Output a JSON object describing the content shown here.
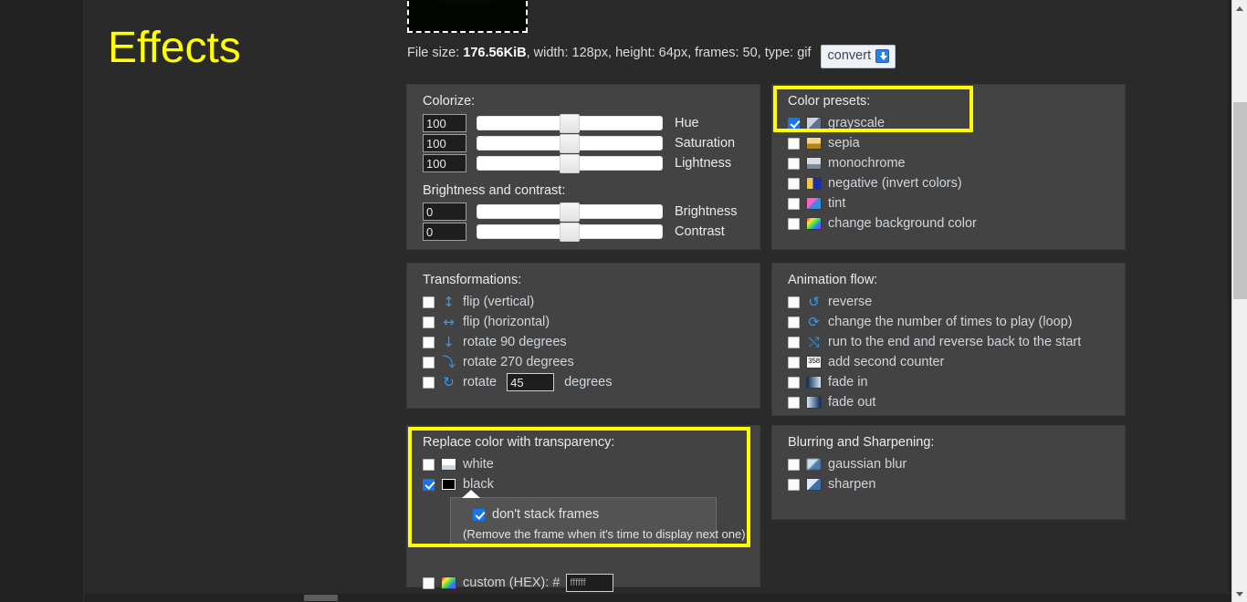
{
  "page": {
    "title": "Effects",
    "title_color": "#ffff00",
    "highlight_color": "#ffff00"
  },
  "preview": {
    "alt": "animated gif preview thumbnail",
    "file_info_prefix": "File size:",
    "file_size": "176.56KiB",
    "file_info_rest": ", width: 128px, height: 64px, frames: 50, type: gif",
    "convert_label": "convert",
    "convert_icon": "download-icon"
  },
  "colorize": {
    "title": "Colorize:",
    "sliders": [
      {
        "value": "100",
        "label": "Hue",
        "position_pct": 50
      },
      {
        "value": "100",
        "label": "Saturation",
        "position_pct": 50
      },
      {
        "value": "100",
        "label": "Lightness",
        "position_pct": 50
      }
    ],
    "brightness_title": "Brightness and contrast:",
    "bc_sliders": [
      {
        "value": "0",
        "label": "Brightness",
        "position_pct": 50
      },
      {
        "value": "0",
        "label": "Contrast",
        "position_pct": 50
      }
    ]
  },
  "color_presets": {
    "title": "Color presets:",
    "items": [
      {
        "label": "grayscale",
        "checked": true,
        "icon": "grayscale-swatch-icon"
      },
      {
        "label": "sepia",
        "checked": false,
        "icon": "sepia-swatch-icon"
      },
      {
        "label": "monochrome",
        "checked": false,
        "icon": "monochrome-swatch-icon"
      },
      {
        "label": "negative (invert colors)",
        "checked": false,
        "icon": "negative-swatch-icon"
      },
      {
        "label": "tint",
        "checked": false,
        "icon": "tint-swatch-icon"
      },
      {
        "label": "change background color",
        "checked": false,
        "icon": "color-wheel-swatch-icon"
      }
    ]
  },
  "transformations": {
    "title": "Transformations:",
    "items": [
      {
        "label": "flip (vertical)",
        "checked": false,
        "icon": "flip-vertical-arrow-icon",
        "glyph": "↕"
      },
      {
        "label": "flip (horizontal)",
        "checked": false,
        "icon": "flip-horizontal-arrow-icon",
        "glyph": "↔"
      },
      {
        "label": "rotate 90 degrees",
        "checked": false,
        "icon": "rotate-90-arrow-icon",
        "glyph": "↓"
      },
      {
        "label": "rotate 270 degrees",
        "checked": false,
        "icon": "rotate-270-arrow-icon",
        "glyph": "⤵"
      },
      {
        "label": "rotate",
        "checked": false,
        "icon": "rotate-custom-arrow-icon",
        "glyph": "↻"
      }
    ],
    "rotate_value": "45",
    "rotate_suffix": "degrees"
  },
  "animation_flow": {
    "title": "Animation flow:",
    "items": [
      {
        "label": "reverse",
        "checked": false,
        "icon": "reverse-arrow-icon",
        "glyph": "↺"
      },
      {
        "label": "change the number of times to play (loop)",
        "checked": false,
        "icon": "loop-count-icon",
        "glyph": "⟳"
      },
      {
        "label": "run to the end and reverse back to the start",
        "checked": false,
        "icon": "boomerang-arrows-icon",
        "glyph": "⤭"
      },
      {
        "label": "add second counter",
        "checked": false,
        "icon": "second-counter-icon",
        "glyph": "358"
      },
      {
        "label": "fade in",
        "checked": false,
        "icon": "fade-in-icon"
      },
      {
        "label": "fade out",
        "checked": false,
        "icon": "fade-out-icon"
      }
    ]
  },
  "replace_transparency": {
    "title": "Replace color with transparency:",
    "items": [
      {
        "label": "white",
        "checked": false,
        "icon": "white-swatch-icon"
      },
      {
        "label": "black",
        "checked": true,
        "icon": "black-swatch-icon"
      }
    ],
    "popup": {
      "checkbox_label": "don't stack frames",
      "checked": true,
      "note": "(Remove the frame when it's time to display next one)"
    },
    "custom": {
      "label": "custom (HEX): #",
      "checked": false,
      "icon": "color-wheel-swatch-icon",
      "value": "",
      "placeholder": "ffffff"
    }
  },
  "blur_sharpen": {
    "title": "Blurring and Sharpening:",
    "items": [
      {
        "label": "gaussian blur",
        "checked": false,
        "icon": "gaussian-blur-icon"
      },
      {
        "label": "sharpen",
        "checked": false,
        "icon": "sharpen-icon"
      }
    ]
  }
}
